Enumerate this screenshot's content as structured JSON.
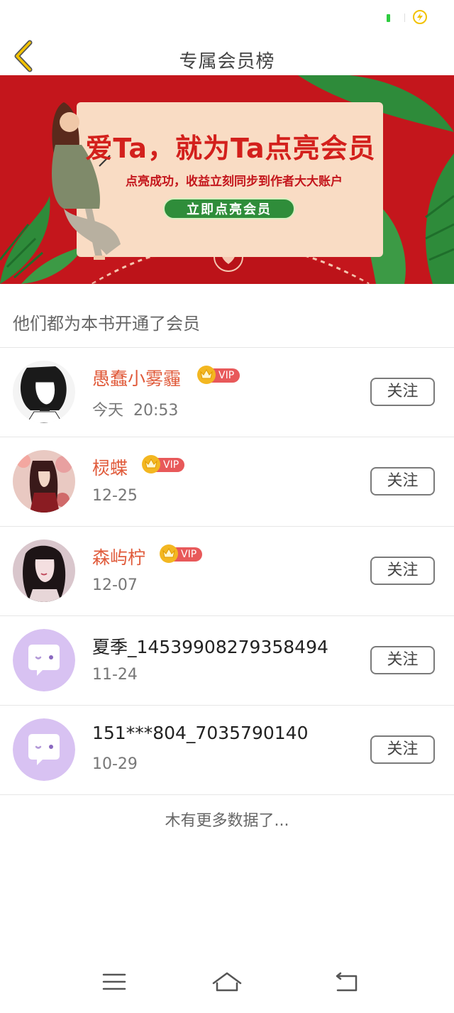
{
  "header": {
    "title": "专属会员榜",
    "back_icon": "chevron-left-icon",
    "accent_color": "#f2c200"
  },
  "banner": {
    "headline": "爱Ta，就为Ta点亮会员",
    "subtitle": "点亮成功，收益立刻同步到作者大大账户",
    "cta": "立即点亮会员",
    "bg_color": "#c4161c"
  },
  "section": {
    "title": "他们都为本书开通了会员"
  },
  "members": [
    {
      "name": "愚蠢小雾霾",
      "date": "今天  20:53",
      "vip": true,
      "vip_label": "VIP",
      "follow": "关注",
      "avatar": "anime-portrait"
    },
    {
      "name": "棂蝶",
      "date": "12-25",
      "vip": true,
      "vip_label": "VIP",
      "follow": "关注",
      "avatar": "anime-portrait"
    },
    {
      "name": "森屿柠",
      "date": "12-07",
      "vip": true,
      "vip_label": "VIP",
      "follow": "关注",
      "avatar": "photo-portrait"
    },
    {
      "name": "夏季_14539908279358494",
      "date": "11-24",
      "vip": false,
      "follow": "关注",
      "avatar": "default-chat-avatar"
    },
    {
      "name": "151***804_7035790140",
      "date": "10-29",
      "vip": false,
      "follow": "关注",
      "avatar": "default-chat-avatar"
    }
  ],
  "footer": {
    "no_more": "木有更多数据了..."
  },
  "navbar": {
    "menu_icon": "menu-icon",
    "home_icon": "home-icon",
    "back_icon": "back-arrow-icon"
  }
}
